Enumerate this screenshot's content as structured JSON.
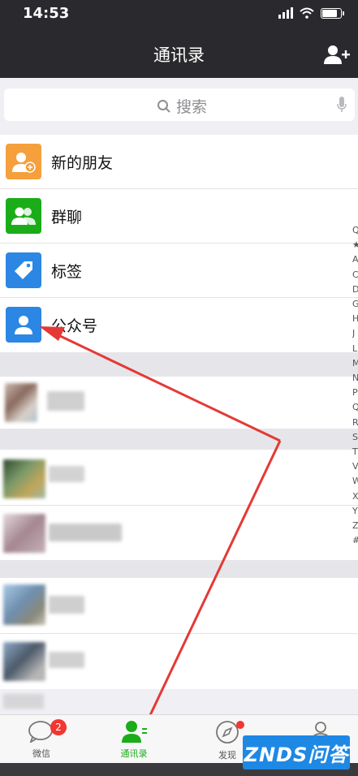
{
  "status": {
    "time": "14:53"
  },
  "nav": {
    "title": "通讯录"
  },
  "search": {
    "placeholder": "搜索"
  },
  "items": [
    {
      "label": "新的朋友",
      "icon": "new-friend-icon",
      "color": "#f5a03c"
    },
    {
      "label": "群聊",
      "icon": "group-chat-icon",
      "color": "#1aad19"
    },
    {
      "label": "标签",
      "icon": "tag-icon",
      "color": "#2b87e3"
    },
    {
      "label": "公众号",
      "icon": "official-account-icon",
      "color": "#2b87e3"
    }
  ],
  "index_letters": [
    "Q",
    "★",
    "A",
    "C",
    "D",
    "G",
    "H",
    "J",
    "L",
    "M",
    "N",
    "P",
    "Q",
    "R",
    "S",
    "T",
    "V",
    "W",
    "X",
    "Y",
    "Z",
    "#"
  ],
  "tabs": [
    {
      "label": "微信",
      "icon": "chat-icon",
      "badge": "2"
    },
    {
      "label": "通讯录",
      "icon": "contacts-icon",
      "active": true
    },
    {
      "label": "发现",
      "icon": "compass-icon"
    },
    {
      "label": "我",
      "icon": "me-icon"
    }
  ],
  "watermark": "ZNDS问答",
  "colors": {
    "accent": "#1aad19",
    "annotation": "#e53935"
  }
}
